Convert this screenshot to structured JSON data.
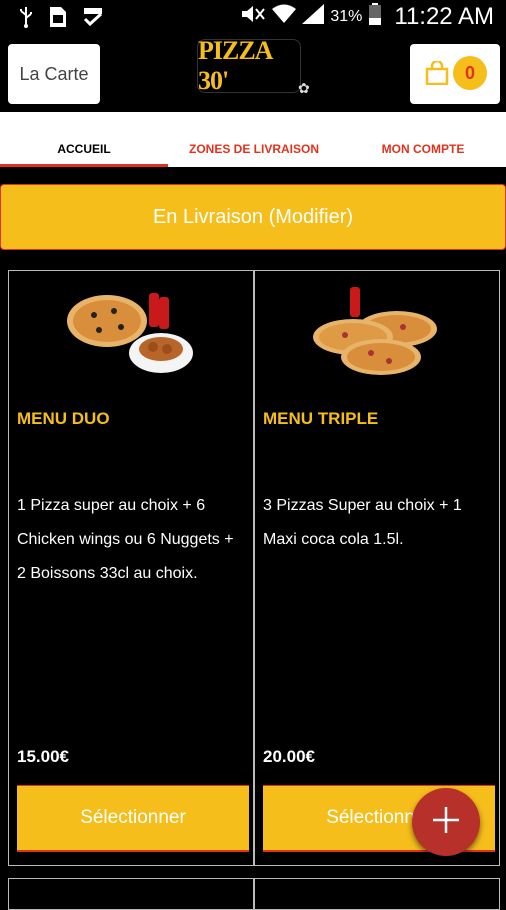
{
  "status_bar": {
    "battery_percent": "31",
    "battery_symbol": "%",
    "time": "11:22 AM"
  },
  "header": {
    "menu_button": "La Carte",
    "logo_text": "PIZZA 30'",
    "cart_count": "0"
  },
  "tabs": [
    {
      "label": "ACCUEIL",
      "active": true
    },
    {
      "label": "ZONES DE LIVRAISON",
      "active": false
    },
    {
      "label": "MON COMPTE",
      "active": false
    }
  ],
  "delivery_mode_button": "En Livraison (Modifier)",
  "menus": [
    {
      "title": "MENU DUO",
      "description": "1 Pizza super au choix  + 6 Chicken wings ou 6 Nuggets  + 2 Boissons 33cl au choix.",
      "price": "15.00€",
      "button": "Sélectionner"
    },
    {
      "title": "MENU TRIPLE",
      "description": "3 Pizzas Super au choix  + 1 Maxi coca cola 1.5l.",
      "price": "20.00€",
      "button": "Sélectionner"
    }
  ],
  "colors": {
    "accent_yellow": "#f6be1b",
    "accent_red": "#e0331e",
    "fab_red": "#b8302a"
  },
  "icons": [
    "usb-icon",
    "sim-icon",
    "check-icon",
    "mute-icon",
    "wifi-icon",
    "signal-icon",
    "battery-icon",
    "shopping-bag-icon",
    "plus-icon"
  ]
}
